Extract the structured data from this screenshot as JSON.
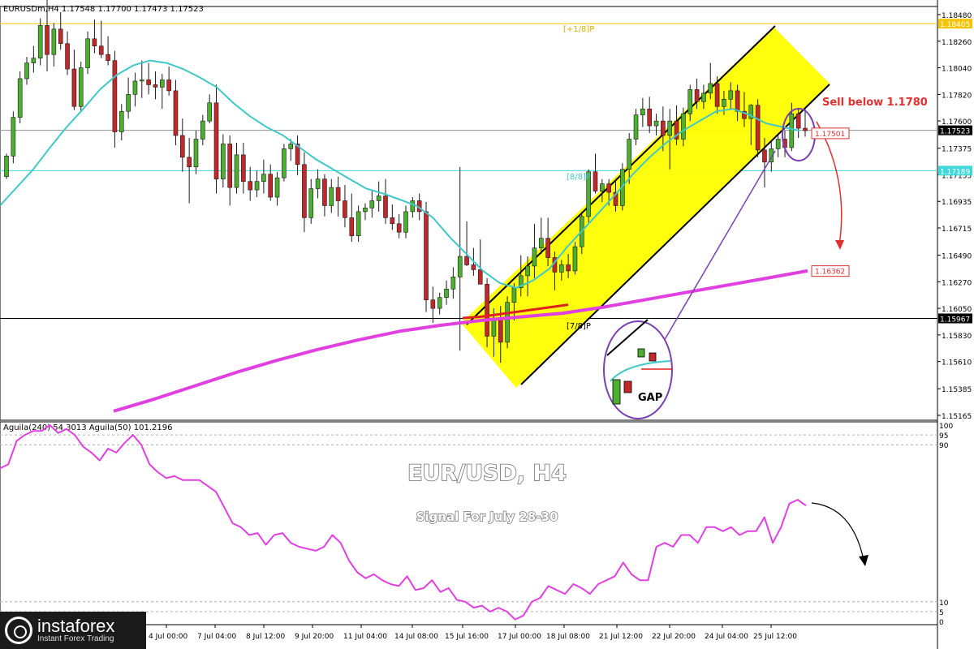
{
  "header": {
    "symbol_line": "EURUSDm,H4  1.17548 1.17700 1.17473 1.17523",
    "indicator_line": "Aguila(240) 54.3013  Aguila(50) 101.2196"
  },
  "overlay": {
    "title": "EUR/USD,  H4",
    "subtitle": "Signal For July 28-30",
    "sell_note": "Sell below 1.1780",
    "gap_label": "GAP",
    "murray_top": "[+1/8]P",
    "murray_mid": "[8/8]P",
    "murray_low": "[7/8]P"
  },
  "colors": {
    "bull": "#4caf30",
    "bear": "#c0282c",
    "channel_fill": "#ffff00",
    "sma_fast": "#40c8c8",
    "sma_slow": "#e040e0",
    "ema_red": "#e02020",
    "sell_note": "#e03030",
    "osc_line": "#e040e0"
  },
  "chart_data": [
    {
      "type": "candlestick",
      "title": "EURUSDm,H4",
      "ylim": [
        1.15165,
        1.1848
      ],
      "y_ticks": [
        "1.18480",
        "1.18260",
        "1.18040",
        "1.17820",
        "1.17600",
        "1.17375",
        "1.17155",
        "1.16935",
        "1.16715",
        "1.16490",
        "1.16270",
        "1.16050",
        "1.15830",
        "1.15610",
        "1.15385",
        "1.15165"
      ],
      "x_ticks": [
        "4 Jul 00:00",
        "7 Jul 04:00",
        "8 Jul 12:00",
        "9 Jul 20:00",
        "11 Jul 04:00",
        "14 Jul 08:00",
        "15 Jul 16:00",
        "17 Jul 00:00",
        "18 Jul 08:00",
        "21 Jul 12:00",
        "22 Jul 20:00",
        "24 Jul 04:00",
        "25 Jul 12:00"
      ],
      "price_labels": [
        {
          "text": "1.18405",
          "price": 1.18405,
          "style": "yellow"
        },
        {
          "text": "1.17523",
          "price": 1.17523,
          "style": "dark"
        },
        {
          "text": "1.17501",
          "price": 1.17501,
          "style": "red-box"
        },
        {
          "text": "1.17189",
          "price": 1.17189,
          "style": "cyan"
        },
        {
          "text": "1.16362",
          "price": 1.16362,
          "style": "magenta-box"
        },
        {
          "text": "1.15967",
          "price": 1.15967,
          "style": "black"
        }
      ],
      "levels": [
        {
          "name": "[+1/8]P",
          "price": 1.18405
        },
        {
          "name": "[8/8]P",
          "price": 1.17189
        },
        {
          "name": "[7/8]P",
          "price": 1.15967
        }
      ],
      "candles": [
        [
          1.1714,
          1.1733,
          1.1712,
          1.1731
        ],
        [
          1.1731,
          1.1768,
          1.1725,
          1.1763
        ],
        [
          1.1763,
          1.1801,
          1.1758,
          1.1795
        ],
        [
          1.1795,
          1.1813,
          1.179,
          1.1808
        ],
        [
          1.1808,
          1.1822,
          1.18,
          1.1812
        ],
        [
          1.1812,
          1.1845,
          1.1806,
          1.1839
        ],
        [
          1.1839,
          1.1869,
          1.1801,
          1.1815
        ],
        [
          1.1815,
          1.1841,
          1.1805,
          1.1836
        ],
        [
          1.1836,
          1.185,
          1.1819,
          1.1824
        ],
        [
          1.1824,
          1.1834,
          1.1798,
          1.1803
        ],
        [
          1.1803,
          1.1819,
          1.1769,
          1.1772
        ],
        [
          1.1772,
          1.1809,
          1.1768,
          1.1804
        ],
        [
          1.1804,
          1.1834,
          1.1799,
          1.1828
        ],
        [
          1.1828,
          1.1844,
          1.1816,
          1.1822
        ],
        [
          1.1822,
          1.1843,
          1.1812,
          1.1815
        ],
        [
          1.1815,
          1.183,
          1.1806,
          1.181
        ],
        [
          1.181,
          1.1818,
          1.1738,
          1.1751
        ],
        [
          1.1751,
          1.1774,
          1.1744,
          1.1768
        ],
        [
          1.1768,
          1.1796,
          1.1762,
          1.1782
        ],
        [
          1.1782,
          1.18,
          1.1772,
          1.1793
        ],
        [
          1.1793,
          1.181,
          1.1779,
          1.1794
        ],
        [
          1.1794,
          1.1808,
          1.1782,
          1.179
        ],
        [
          1.179,
          1.1801,
          1.1778,
          1.1788
        ],
        [
          1.1788,
          1.1799,
          1.177,
          1.1794
        ],
        [
          1.1794,
          1.1805,
          1.1781,
          1.1785
        ],
        [
          1.1785,
          1.1794,
          1.174,
          1.1748
        ],
        [
          1.1748,
          1.1762,
          1.1718,
          1.173
        ],
        [
          1.173,
          1.1746,
          1.1692,
          1.1722
        ],
        [
          1.1722,
          1.1752,
          1.1716,
          1.1745
        ],
        [
          1.1745,
          1.1765,
          1.174,
          1.176
        ],
        [
          1.176,
          1.1782,
          1.1758,
          1.1775
        ],
        [
          1.1775,
          1.179,
          1.17,
          1.1712
        ],
        [
          1.1712,
          1.1749,
          1.1705,
          1.1741
        ],
        [
          1.1741,
          1.1748,
          1.169,
          1.1705
        ],
        [
          1.1705,
          1.1742,
          1.17,
          1.1732
        ],
        [
          1.1732,
          1.1742,
          1.17,
          1.171
        ],
        [
          1.171,
          1.1722,
          1.1694,
          1.1703
        ],
        [
          1.1703,
          1.1719,
          1.1697,
          1.171
        ],
        [
          1.171,
          1.1728,
          1.17,
          1.1716
        ],
        [
          1.1716,
          1.1724,
          1.1694,
          1.1697
        ],
        [
          1.1697,
          1.1718,
          1.169,
          1.1713
        ],
        [
          1.1713,
          1.1741,
          1.171,
          1.1737
        ],
        [
          1.1737,
          1.1745,
          1.1727,
          1.1741
        ],
        [
          1.1741,
          1.1748,
          1.1715,
          1.1724
        ],
        [
          1.1724,
          1.1734,
          1.1668,
          1.168
        ],
        [
          1.168,
          1.1712,
          1.1675,
          1.1704
        ],
        [
          1.1704,
          1.172,
          1.1696,
          1.1712
        ],
        [
          1.1712,
          1.1716,
          1.1681,
          1.169
        ],
        [
          1.169,
          1.1712,
          1.1684,
          1.1705
        ],
        [
          1.1705,
          1.1714,
          1.1681,
          1.1694
        ],
        [
          1.1694,
          1.1707,
          1.1672,
          1.168
        ],
        [
          1.168,
          1.17,
          1.166,
          1.1665
        ],
        [
          1.1665,
          1.169,
          1.166,
          1.1685
        ],
        [
          1.1685,
          1.1692,
          1.1678,
          1.1688
        ],
        [
          1.1688,
          1.1703,
          1.168,
          1.1694
        ],
        [
          1.1694,
          1.171,
          1.1685,
          1.1698
        ],
        [
          1.1698,
          1.1712,
          1.1675,
          1.168
        ],
        [
          1.168,
          1.1691,
          1.167,
          1.1675
        ],
        [
          1.1675,
          1.1683,
          1.1663,
          1.1668
        ],
        [
          1.1668,
          1.169,
          1.1663,
          1.1685
        ],
        [
          1.1685,
          1.1697,
          1.168,
          1.1694
        ],
        [
          1.1694,
          1.17,
          1.1678,
          1.1685
        ],
        [
          1.1685,
          1.1693,
          1.1602,
          1.1612
        ],
        [
          1.1612,
          1.1623,
          1.1593,
          1.1605
        ],
        [
          1.1605,
          1.1618,
          1.16,
          1.1614
        ],
        [
          1.1614,
          1.1628,
          1.1608,
          1.1621
        ],
        [
          1.1621,
          1.1639,
          1.1613,
          1.1631
        ],
        [
          1.1631,
          1.1722,
          1.157,
          1.1648
        ],
        [
          1.1648,
          1.1677,
          1.164,
          1.1641
        ],
        [
          1.1641,
          1.1655,
          1.1632,
          1.1637
        ],
        [
          1.1637,
          1.1662,
          1.163,
          1.1625
        ],
        [
          1.1625,
          1.163,
          1.1573,
          1.1582
        ],
        [
          1.1582,
          1.1605,
          1.1565,
          1.1597
        ],
        [
          1.1597,
          1.1607,
          1.156,
          1.1577
        ],
        [
          1.1577,
          1.1615,
          1.1572,
          1.161
        ],
        [
          1.161,
          1.1626,
          1.1595,
          1.1622
        ],
        [
          1.1622,
          1.1649,
          1.1615,
          1.1632
        ],
        [
          1.1632,
          1.1648,
          1.1615,
          1.164
        ],
        [
          1.164,
          1.1675,
          1.163,
          1.1655
        ],
        [
          1.1655,
          1.168,
          1.165,
          1.1663
        ],
        [
          1.1663,
          1.168,
          1.164,
          1.1647
        ],
        [
          1.1647,
          1.1652,
          1.162,
          1.1635
        ],
        [
          1.1635,
          1.1645,
          1.1628,
          1.1641
        ],
        [
          1.1641,
          1.165,
          1.163,
          1.1636
        ],
        [
          1.1636,
          1.166,
          1.1633,
          1.1656
        ],
        [
          1.1656,
          1.1685,
          1.165,
          1.1681
        ],
        [
          1.1681,
          1.172,
          1.1676,
          1.1718
        ],
        [
          1.1718,
          1.1733,
          1.17,
          1.1702
        ],
        [
          1.1702,
          1.1712,
          1.1693,
          1.1708
        ],
        [
          1.1708,
          1.1712,
          1.169,
          1.1701
        ],
        [
          1.1701,
          1.1712,
          1.1685,
          1.169
        ],
        [
          1.169,
          1.1725,
          1.1686,
          1.172
        ],
        [
          1.172,
          1.175,
          1.1708,
          1.1745
        ],
        [
          1.1745,
          1.177,
          1.174,
          1.1765
        ],
        [
          1.1765,
          1.1779,
          1.1755,
          1.177
        ],
        [
          1.177,
          1.178,
          1.175,
          1.1756
        ],
        [
          1.1756,
          1.1766,
          1.1748,
          1.176
        ],
        [
          1.176,
          1.1772,
          1.1735,
          1.1748
        ],
        [
          1.1748,
          1.177,
          1.172,
          1.176
        ],
        [
          1.176,
          1.1773,
          1.174,
          1.1745
        ],
        [
          1.1745,
          1.1771,
          1.1739,
          1.1766
        ],
        [
          1.1766,
          1.179,
          1.176,
          1.1786
        ],
        [
          1.1786,
          1.1795,
          1.177,
          1.1776
        ],
        [
          1.1776,
          1.179,
          1.177,
          1.1783
        ],
        [
          1.1783,
          1.1808,
          1.1778,
          1.1791
        ],
        [
          1.1791,
          1.1797,
          1.1766,
          1.1772
        ],
        [
          1.1772,
          1.1785,
          1.1765,
          1.1778
        ],
        [
          1.1778,
          1.1792,
          1.177,
          1.1785
        ],
        [
          1.1785,
          1.179,
          1.176,
          1.1768
        ],
        [
          1.1768,
          1.1784,
          1.1755,
          1.1762
        ],
        [
          1.1762,
          1.1774,
          1.174,
          1.1773
        ],
        [
          1.1773,
          1.1778,
          1.173,
          1.1736
        ],
        [
          1.1736,
          1.1746,
          1.1705,
          1.1726
        ],
        [
          1.1726,
          1.1744,
          1.1718,
          1.1737
        ],
        [
          1.1737,
          1.1749,
          1.173,
          1.1745
        ],
        [
          1.1745,
          1.1752,
          1.173,
          1.1738
        ],
        [
          1.1738,
          1.1775,
          1.1735,
          1.1766
        ],
        [
          1.1766,
          1.177,
          1.1746,
          1.1754
        ],
        [
          1.1754,
          1.177,
          1.1747,
          1.1752
        ]
      ],
      "series": [
        {
          "name": "SMA fast",
          "values": [
            1.169,
            1.1705,
            1.172,
            1.1738,
            1.1755,
            1.177,
            1.1786,
            1.1798,
            1.1806,
            1.181,
            1.1808,
            1.1803,
            1.1796,
            1.1788,
            1.1775,
            1.1764,
            1.1755,
            1.1748,
            1.1738,
            1.1728,
            1.172,
            1.1712,
            1.1704,
            1.17,
            1.1695,
            1.169,
            1.168,
            1.1664,
            1.165,
            1.1636,
            1.1626,
            1.1622,
            1.1628,
            1.1638,
            1.1655,
            1.167,
            1.1685,
            1.17,
            1.1716,
            1.173,
            1.1742,
            1.1752,
            1.176,
            1.1768,
            1.177,
            1.1765,
            1.1758,
            1.1755,
            1.1752
          ]
        },
        {
          "name": "SMA slow",
          "values": [
            1.152,
            1.153,
            1.1541,
            1.1552,
            1.1562,
            1.1571,
            1.1579,
            1.1586,
            1.1591,
            1.1595,
            1.1598,
            1.1601,
            1.1606,
            1.1612,
            1.1618,
            1.1624,
            1.163,
            1.1636
          ]
        },
        {
          "name": "EMA red",
          "values": [
            1.1597,
            1.1598,
            1.16,
            1.1602,
            1.1604,
            1.1606,
            1.1608
          ]
        }
      ]
    },
    {
      "type": "line",
      "title": "Aguila(240) 54.3013  Aguila(50) 101.2196",
      "ylim": [
        0,
        100
      ],
      "y_ticks": [
        "100",
        "95",
        "90",
        "10",
        "5",
        "0"
      ],
      "series": [
        {
          "name": "Aguila(50)",
          "values": [
            78,
            80,
            92,
            95,
            97,
            97,
            100,
            96,
            98,
            95,
            89,
            86,
            82,
            88,
            86,
            91,
            95,
            90,
            80,
            76,
            73,
            74,
            72,
            72,
            72,
            69,
            66,
            58,
            50,
            48,
            44,
            45,
            39,
            44,
            45,
            40,
            38,
            37,
            36,
            38,
            44,
            40,
            31,
            25,
            22,
            24,
            21,
            19,
            18,
            23,
            16,
            17,
            21,
            15,
            17,
            11,
            10,
            7,
            8,
            5,
            7,
            5,
            1,
            3,
            10,
            12,
            18,
            16,
            14,
            19,
            17,
            14,
            19,
            21,
            23,
            30,
            24,
            21,
            21,
            38,
            40,
            38,
            44,
            44,
            40,
            48,
            48,
            46,
            48,
            44,
            46,
            46,
            53,
            40,
            48,
            60,
            62,
            59
          ]
        }
      ]
    }
  ]
}
